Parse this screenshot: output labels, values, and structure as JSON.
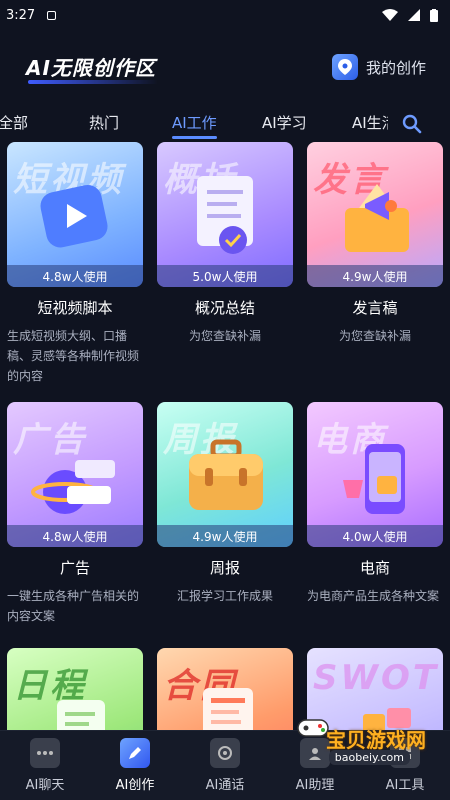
{
  "status": {
    "time": "3:27"
  },
  "header": {
    "brand": "AI无限创作区",
    "my_work": "我的创作"
  },
  "tabs": [
    "全部",
    "热门",
    "AI工作",
    "AI学习",
    "AI生活"
  ],
  "active_tab": "AI工作",
  "cards": [
    {
      "banner": "短视频",
      "usage": "4.8w人使用",
      "title": "短视频脚本",
      "desc": "生成短视频大纲、口播稿、灵感等各种制作视频的内容"
    },
    {
      "banner": "概括",
      "usage": "5.0w人使用",
      "title": "概况总结",
      "desc": "为您查缺补漏"
    },
    {
      "banner": "发言",
      "usage": "4.9w人使用",
      "title": "发言稿",
      "desc": "为您查缺补漏"
    },
    {
      "banner": "广告",
      "usage": "4.8w人使用",
      "title": "广告",
      "desc": "一键生成各种广告相关的内容文案"
    },
    {
      "banner": "周报",
      "usage": "4.9w人使用",
      "title": "周报",
      "desc": "汇报学习工作成果"
    },
    {
      "banner": "电商",
      "usage": "4.0w人使用",
      "title": "电商",
      "desc": "为电商产品生成各种文案"
    },
    {
      "banner": "日程",
      "usage": "",
      "title": "",
      "desc": ""
    },
    {
      "banner": "合同",
      "usage": "",
      "title": "",
      "desc": ""
    },
    {
      "banner": "SWOT",
      "usage": "",
      "title": "",
      "desc": ""
    }
  ],
  "bottom_nav": [
    {
      "label": "AI聊天",
      "icon": "chat-icon"
    },
    {
      "label": "AI创作",
      "icon": "pen-icon"
    },
    {
      "label": "AI通话",
      "icon": "phone-icon"
    },
    {
      "label": "AI助理",
      "icon": "assistant-icon"
    },
    {
      "label": "AI工具",
      "icon": "tools-icon"
    }
  ],
  "watermark": {
    "text": "宝贝游戏网",
    "url": "baobeiy.com"
  },
  "colors": {
    "background": "#0f1320",
    "accent": "#5b8cff"
  }
}
